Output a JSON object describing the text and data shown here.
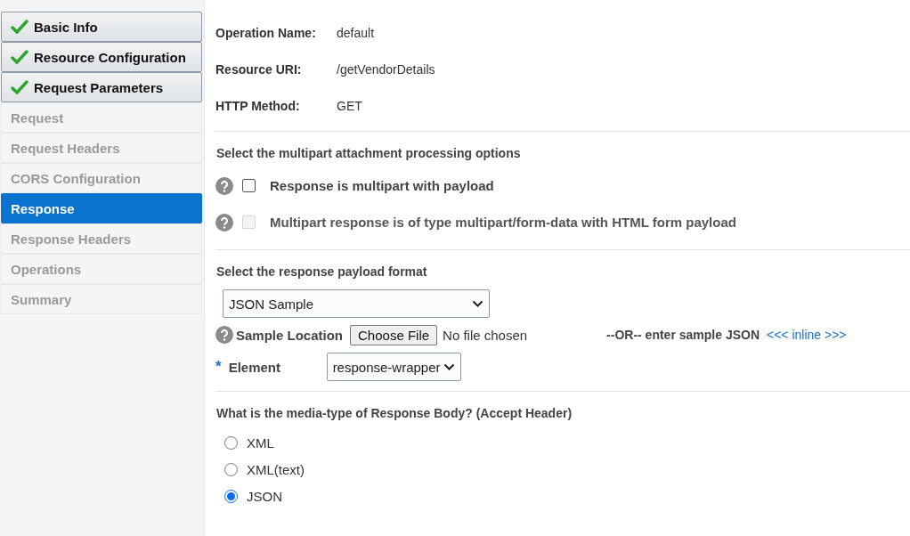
{
  "sidebar": {
    "items": [
      {
        "label": "Basic Info",
        "done": true,
        "selected": false
      },
      {
        "label": "Resource Configuration",
        "done": true,
        "selected": false
      },
      {
        "label": "Request Parameters",
        "done": true,
        "selected": false
      },
      {
        "label": "Request",
        "done": false,
        "selected": false
      },
      {
        "label": "Request Headers",
        "done": false,
        "selected": false
      },
      {
        "label": "CORS Configuration",
        "done": false,
        "selected": false
      },
      {
        "label": "Response",
        "done": false,
        "selected": true
      },
      {
        "label": "Response Headers",
        "done": false,
        "selected": false
      },
      {
        "label": "Operations",
        "done": false,
        "selected": false
      },
      {
        "label": "Summary",
        "done": false,
        "selected": false
      }
    ]
  },
  "summary": [
    {
      "label": "Operation Name:",
      "value": "default"
    },
    {
      "label": "Resource URI:",
      "value": "/getVendorDetails"
    },
    {
      "label": "HTTP Method:",
      "value": "GET"
    }
  ],
  "multipart": {
    "heading": "Select the multipart attachment processing options",
    "options": [
      {
        "label": "Response is multipart with payload",
        "checked": false,
        "disabled": false
      },
      {
        "label": "Multipart response is of type multipart/form-data with HTML form payload",
        "checked": false,
        "disabled": true
      }
    ]
  },
  "payload": {
    "heading": "Select the response payload format",
    "format": "JSON Sample",
    "sample_location_label": "Sample Location",
    "choose_file": "Choose File",
    "file_status": "No file chosen",
    "or_text": "--OR-- enter sample JSON",
    "inline_link": "<<< inline >>>",
    "element_required": "*",
    "element_label": "Element",
    "element_value": "response-wrapper"
  },
  "media_type": {
    "heading": "What is the media-type of Response Body? (Accept Header)",
    "options": [
      {
        "label": "XML",
        "selected": false
      },
      {
        "label": "XML(text)",
        "selected": false
      },
      {
        "label": "JSON",
        "selected": true
      }
    ]
  }
}
